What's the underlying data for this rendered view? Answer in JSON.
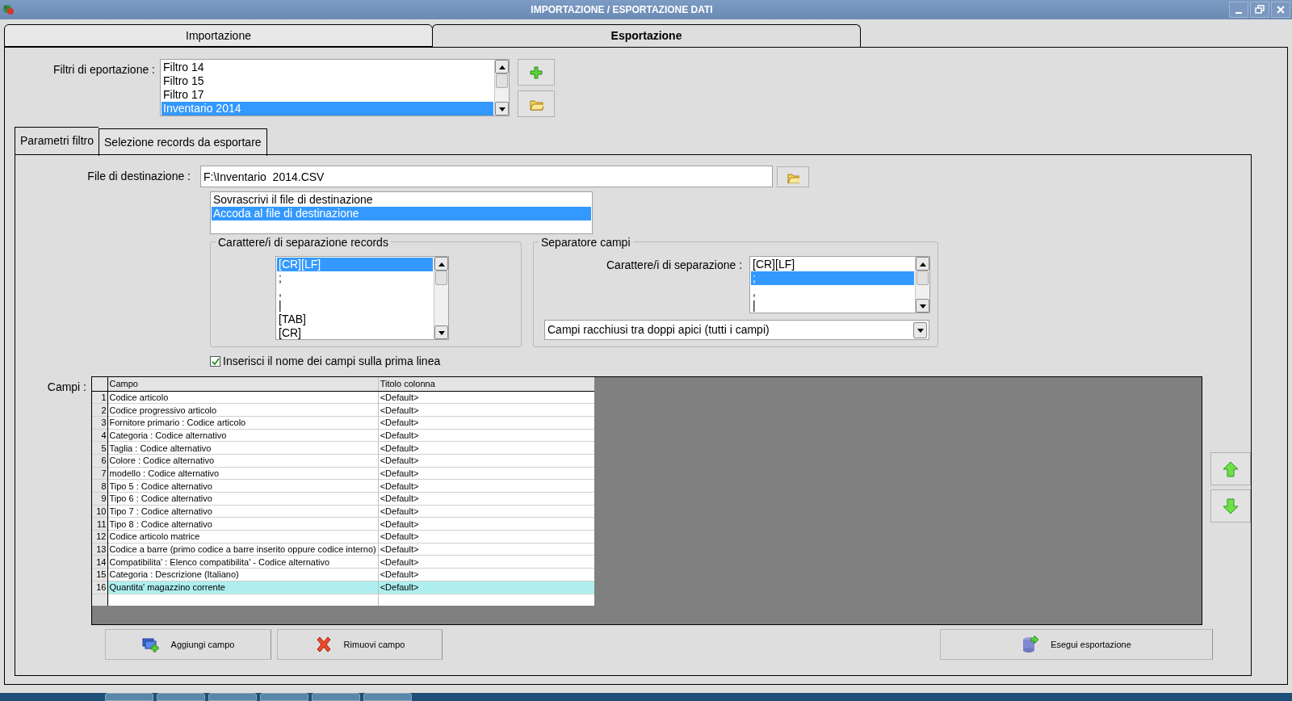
{
  "window": {
    "title": "IMPORTAZIONE / ESPORTAZIONE DATI"
  },
  "tabs": [
    {
      "label": "Importazione",
      "selected": false
    },
    {
      "label": "Esportazione",
      "selected": true
    }
  ],
  "export_filters": {
    "label": "Filtri di eportazione :",
    "items": [
      {
        "label": "Filtro 14",
        "selected": false
      },
      {
        "label": "Filtro 15",
        "selected": false
      },
      {
        "label": "Filtro 17",
        "selected": false
      },
      {
        "label": "Inventario 2014",
        "selected": true
      }
    ]
  },
  "subtabs": [
    {
      "label": "Parametri filtro",
      "selected": true
    },
    {
      "label": "Selezione records da esportare",
      "selected": false
    }
  ],
  "destination": {
    "label": "File di destinazione :",
    "value": "F:\\Inventario  2014.CSV"
  },
  "write_mode": [
    {
      "label": "Sovrascrivi il file di destinazione",
      "selected": false
    },
    {
      "label": "Accoda al file di destinazione",
      "selected": true
    }
  ],
  "record_separator": {
    "title": "Carattere/i di separazione records",
    "items": [
      {
        "label": "[CR][LF]",
        "selected": true
      },
      {
        "label": ";",
        "selected": false
      },
      {
        "label": ",",
        "selected": false
      },
      {
        "label": "|",
        "selected": false
      },
      {
        "label": "[TAB]",
        "selected": false
      },
      {
        "label": "[CR]",
        "selected": false
      }
    ]
  },
  "field_separator": {
    "title": "Separatore campi",
    "label": "Carattere/i di separazione :",
    "items": [
      {
        "label": "[CR][LF]",
        "selected": false
      },
      {
        "label": ";",
        "selected": true
      },
      {
        "label": ",",
        "selected": false
      },
      {
        "label": "|",
        "selected": false
      }
    ],
    "quoting": "Campi racchiusi tra doppi apici (tutti i campi)"
  },
  "header_checkbox": {
    "label": "Inserisci il nome dei campi sulla prima linea",
    "checked": true
  },
  "fields": {
    "label": "Campi :",
    "columns": [
      "Campo",
      "Titolo colonna"
    ],
    "rows": [
      {
        "number": "1",
        "field": "Codice articolo",
        "title": "<Default>",
        "selected": false
      },
      {
        "number": "2",
        "field": "Codice progressivo articolo",
        "title": "<Default>",
        "selected": false
      },
      {
        "number": "3",
        "field": "Fornitore primario : Codice articolo",
        "title": "<Default>",
        "selected": false
      },
      {
        "number": "4",
        "field": "Categoria : Codice alternativo",
        "title": "<Default>",
        "selected": false
      },
      {
        "number": "5",
        "field": "Taglia : Codice alternativo",
        "title": "<Default>",
        "selected": false
      },
      {
        "number": "6",
        "field": "Colore : Codice alternativo",
        "title": "<Default>",
        "selected": false
      },
      {
        "number": "7",
        "field": "modello  : Codice alternativo",
        "title": "<Default>",
        "selected": false
      },
      {
        "number": "8",
        "field": "Tipo 5 : Codice alternativo",
        "title": "<Default>",
        "selected": false
      },
      {
        "number": "9",
        "field": "Tipo 6 : Codice alternativo",
        "title": "<Default>",
        "selected": false
      },
      {
        "number": "10",
        "field": "Tipo 7 : Codice alternativo",
        "title": "<Default>",
        "selected": false
      },
      {
        "number": "11",
        "field": "Tipo 8 : Codice alternativo",
        "title": "<Default>",
        "selected": false
      },
      {
        "number": "12",
        "field": "Codice articolo matrice",
        "title": "<Default>",
        "selected": false
      },
      {
        "number": "13",
        "field": "Codice a barre (primo codice a barre inserito oppure codice interno)",
        "title": "<Default>",
        "selected": false
      },
      {
        "number": "14",
        "field": "Compatibilita' : Elenco compatibilita' - Codice alternativo",
        "title": "<Default>",
        "selected": false
      },
      {
        "number": "15",
        "field": "Categoria : Descrizione (Italiano)",
        "title": "<Default>",
        "selected": false
      },
      {
        "number": "16",
        "field": "Quantita' magazzino corrente",
        "title": "<Default>",
        "selected": true
      }
    ]
  },
  "buttons": {
    "add": "Aggiungi campo",
    "remove": "Rimuovi campo",
    "export": "Esegui esportazione"
  }
}
